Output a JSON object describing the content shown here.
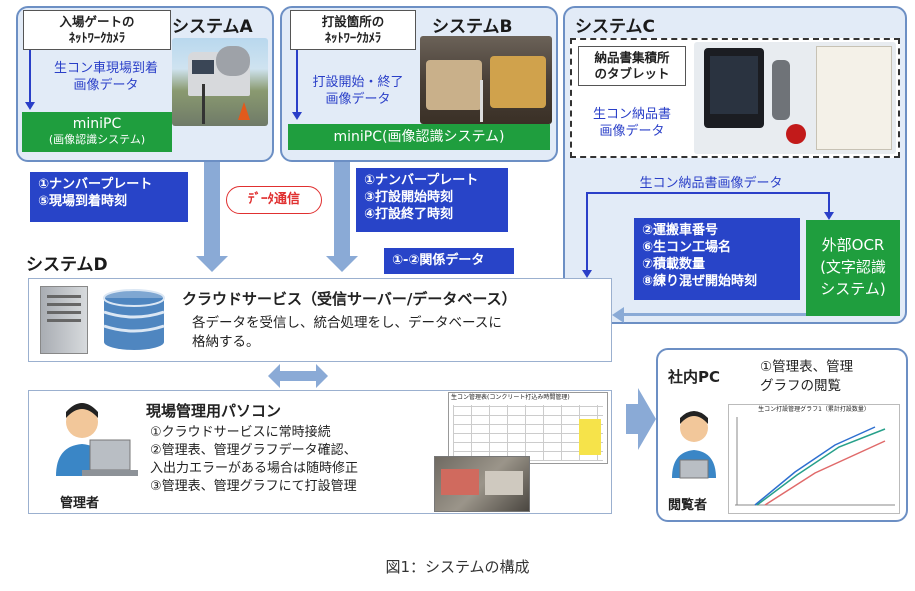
{
  "systemA": {
    "title": "システムA",
    "camera_label_l1": "入場ゲートの",
    "camera_label_l2": "ﾈｯﾄﾜｰｸｶﾒﾗ",
    "data_l1": "生コン車現場到着",
    "data_l2": "画像データ",
    "minipc_l1": "miniPC",
    "minipc_l2": "(画像認識システム)"
  },
  "systemB": {
    "title": "システムB",
    "camera_label_l1": "打設箇所の",
    "camera_label_l2": "ﾈｯﾄﾜｰｸｶﾒﾗ",
    "data_l1": "打設開始・終了",
    "data_l2": "画像データ",
    "minipc": "miniPC(画像認識システム)"
  },
  "systemC": {
    "title": "システムC",
    "tablet_l1": "納品書集積所",
    "tablet_l2": "のタブレット",
    "data_l1": "生コン納品書",
    "data_l2": "画像データ",
    "flow_label": "生コン納品書画像データ"
  },
  "labels": {
    "a_items": [
      "①ナンバープレート",
      "⑤現場到着時刻"
    ],
    "b_items": [
      "①ナンバープレート",
      "③打設開始時刻",
      "④打設終了時刻"
    ],
    "relation": "①-②関係データ",
    "ocr_items": [
      "②運搬車番号",
      "⑥生コン工場名",
      "⑦積載数量",
      "⑧練り混ぜ開始時刻"
    ],
    "comm": "ﾃﾞｰﾀ通信"
  },
  "ocr": {
    "l1": "外部OCR",
    "l2": "(文字認識",
    "l3": "システム)"
  },
  "systemD": {
    "title": "システムD",
    "cloud_title": "クラウドサービス（受信サーバー/データベース）",
    "cloud_desc_l1": "各データを受信し、統合処理をし、データベースに",
    "cloud_desc_l2": "格納する。",
    "pc_title": "現場管理用パソコン",
    "pc_items": [
      "①クラウドサービスに常時接続",
      "②管理表、管理グラフデータ確認、",
      "入出力エラーがある場合は随時修正",
      "③管理表、管理グラフにて打設管理"
    ],
    "manager": "管理者",
    "table_title": "生コン管理表(コンクリート打込み時間管理)"
  },
  "internal": {
    "title": "社内PC",
    "item_l1": "①管理表、管理",
    "item_l2": "グラフの閲覧",
    "viewer": "閲覧者",
    "graph_title": "生コン打設管理グラフ1（累計打設数量）"
  },
  "caption": "図1：システムの構成",
  "colors": {
    "system_bg": "#e2ebf7",
    "system_border": "#6c8fc4",
    "green": "#1f9e3e",
    "blue_label": "#2844c8",
    "blue_text": "#2a3fc8",
    "comm_red": "#e03030",
    "arrow": "#8aaad6"
  },
  "icons": [
    "server-icon",
    "database-icon",
    "person-laptop-icon",
    "double-arrow-icon",
    "right-arrow-icon",
    "down-arrow-icon"
  ]
}
